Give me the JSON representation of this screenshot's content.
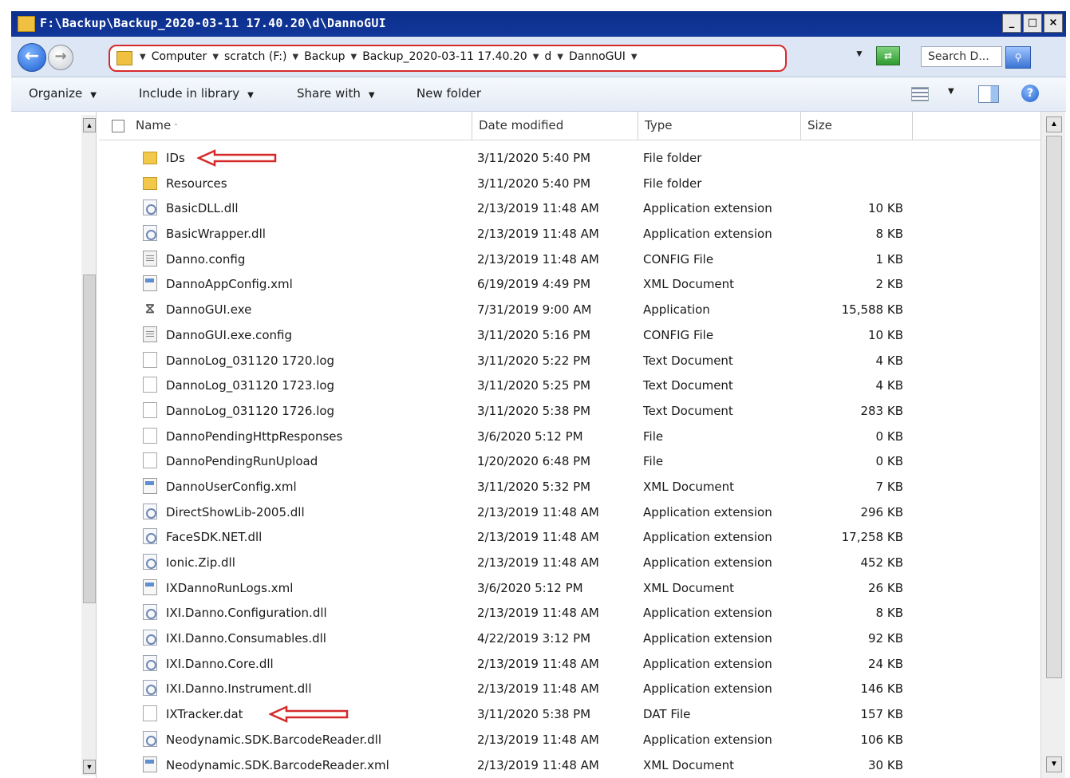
{
  "window": {
    "title": "F:\\Backup\\Backup_2020-03-11 17.40.20\\d\\DannoGUI",
    "buttons": [
      "_",
      "□",
      "×"
    ]
  },
  "address": {
    "crumbs": [
      "Computer",
      "scratch (F:)",
      "Backup",
      "Backup_2020-03-11 17.40.20",
      "d",
      "DannoGUI"
    ],
    "highlight_color": "#d62a2a"
  },
  "search": {
    "placeholder": "Search D..."
  },
  "toolbar": {
    "organize": "Organize",
    "include_in_library": "Include in library",
    "share_with": "Share with",
    "new_folder": "New folder"
  },
  "columns": {
    "name": "Name",
    "date_modified": "Date modified",
    "type": "Type",
    "size": "Size"
  },
  "files": [
    {
      "icon": "folder-icon",
      "name": "IDs",
      "date": "3/11/2020 5:40 PM",
      "type": "File folder",
      "size": "",
      "arrow": true
    },
    {
      "icon": "folder-icon",
      "name": "Resources",
      "date": "3/11/2020 5:40 PM",
      "type": "File folder",
      "size": ""
    },
    {
      "icon": "dll-icon",
      "name": "BasicDLL.dll",
      "date": "2/13/2019 11:48 AM",
      "type": "Application extension",
      "size": "10 KB"
    },
    {
      "icon": "dll-icon",
      "name": "BasicWrapper.dll",
      "date": "2/13/2019 11:48 AM",
      "type": "Application extension",
      "size": "8 KB"
    },
    {
      "icon": "config-icon",
      "name": "Danno.config",
      "date": "2/13/2019 11:48 AM",
      "type": "CONFIG File",
      "size": "1 KB"
    },
    {
      "icon": "xml-icon",
      "name": "DannoAppConfig.xml",
      "date": "6/19/2019 4:49 PM",
      "type": "XML Document",
      "size": "2 KB"
    },
    {
      "icon": "exe-icon",
      "name": "DannoGUI.exe",
      "date": "7/31/2019 9:00 AM",
      "type": "Application",
      "size": "15,588 KB"
    },
    {
      "icon": "config-icon",
      "name": "DannoGUI.exe.config",
      "date": "3/11/2020 5:16 PM",
      "type": "CONFIG File",
      "size": "10 KB"
    },
    {
      "icon": "file-icon",
      "name": "DannoLog_031120 1720.log",
      "date": "3/11/2020 5:22 PM",
      "type": "Text Document",
      "size": "4 KB"
    },
    {
      "icon": "file-icon",
      "name": "DannoLog_031120 1723.log",
      "date": "3/11/2020 5:25 PM",
      "type": "Text Document",
      "size": "4 KB"
    },
    {
      "icon": "file-icon",
      "name": "DannoLog_031120 1726.log",
      "date": "3/11/2020 5:38 PM",
      "type": "Text Document",
      "size": "283 KB"
    },
    {
      "icon": "file-icon",
      "name": "DannoPendingHttpResponses",
      "date": "3/6/2020 5:12 PM",
      "type": "File",
      "size": "0 KB"
    },
    {
      "icon": "file-icon",
      "name": "DannoPendingRunUpload",
      "date": "1/20/2020 6:48 PM",
      "type": "File",
      "size": "0 KB"
    },
    {
      "icon": "xml-icon",
      "name": "DannoUserConfig.xml",
      "date": "3/11/2020 5:32 PM",
      "type": "XML Document",
      "size": "7 KB"
    },
    {
      "icon": "dll-icon",
      "name": "DirectShowLib-2005.dll",
      "date": "2/13/2019 11:48 AM",
      "type": "Application extension",
      "size": "296 KB"
    },
    {
      "icon": "dll-icon",
      "name": "FaceSDK.NET.dll",
      "date": "2/13/2019 11:48 AM",
      "type": "Application extension",
      "size": "17,258 KB"
    },
    {
      "icon": "dll-icon",
      "name": "Ionic.Zip.dll",
      "date": "2/13/2019 11:48 AM",
      "type": "Application extension",
      "size": "452 KB"
    },
    {
      "icon": "xml-icon",
      "name": "IXDannoRunLogs.xml",
      "date": "3/6/2020 5:12 PM",
      "type": "XML Document",
      "size": "26 KB"
    },
    {
      "icon": "dll-icon",
      "name": "IXI.Danno.Configuration.dll",
      "date": "2/13/2019 11:48 AM",
      "type": "Application extension",
      "size": "8 KB"
    },
    {
      "icon": "dll-icon",
      "name": "IXI.Danno.Consumables.dll",
      "date": "4/22/2019 3:12 PM",
      "type": "Application extension",
      "size": "92 KB"
    },
    {
      "icon": "dll-icon",
      "name": "IXI.Danno.Core.dll",
      "date": "2/13/2019 11:48 AM",
      "type": "Application extension",
      "size": "24 KB"
    },
    {
      "icon": "dll-icon",
      "name": "IXI.Danno.Instrument.dll",
      "date": "2/13/2019 11:48 AM",
      "type": "Application extension",
      "size": "146 KB"
    },
    {
      "icon": "file-icon",
      "name": "IXTracker.dat",
      "date": "3/11/2020 5:38 PM",
      "type": "DAT File",
      "size": "157 KB",
      "arrow": true
    },
    {
      "icon": "dll-icon",
      "name": "Neodynamic.SDK.BarcodeReader.dll",
      "date": "2/13/2019 11:48 AM",
      "type": "Application extension",
      "size": "106 KB"
    },
    {
      "icon": "xml-icon",
      "name": "Neodynamic.SDK.BarcodeReader.xml",
      "date": "2/13/2019 11:48 AM",
      "type": "XML Document",
      "size": "30 KB"
    }
  ],
  "colors": {
    "titlebar": "#0b2f8c",
    "annotation_arrow": "#d62a2a",
    "folder": "#f2c84a"
  }
}
